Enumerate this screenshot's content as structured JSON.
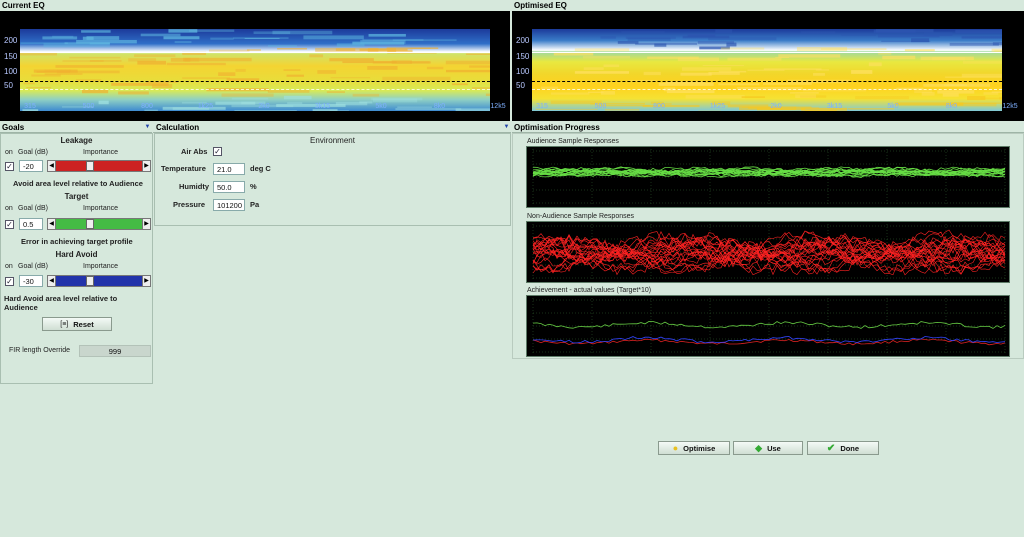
{
  "current_eq": {
    "title": "Current EQ",
    "y_ticks": [
      "200",
      "150",
      "100",
      "50"
    ],
    "x_ticks": [
      "315",
      "500",
      "800",
      "1k25",
      "2k0",
      "3k15",
      "5k0",
      "8k0",
      "12k5"
    ]
  },
  "optimised_eq": {
    "title": "Optimised EQ",
    "y_ticks": [
      "200",
      "150",
      "100",
      "50"
    ],
    "x_ticks": [
      "315",
      "500",
      "800",
      "1k25",
      "2k0",
      "3k15",
      "5k0",
      "8k0",
      "12k5"
    ]
  },
  "goals": {
    "title": "Goals",
    "leakage": {
      "header": "Leakage",
      "on_label": "on",
      "goal_label": "Goal (dB)",
      "importance_label": "Importance",
      "goal_value": "-20",
      "importance": 0.35,
      "color": "#cc2222",
      "description": "Avoid area level relative to Audience"
    },
    "target": {
      "header": "Target",
      "on_label": "on",
      "goal_label": "Goal (dB)",
      "importance_label": "Importance",
      "goal_value": "0.5",
      "importance": 0.35,
      "color": "#44bb44",
      "description": "Error in achieving target profile"
    },
    "hard_avoid": {
      "header": "Hard Avoid",
      "on_label": "on",
      "goal_label": "Goal (dB)",
      "importance_label": "Importance",
      "goal_value": "-30",
      "importance": 0.35,
      "color": "#2233aa",
      "description": "Hard Avoid area level relative to Audience"
    },
    "reset_label": "Reset",
    "fir_label": "FIR length Override",
    "fir_value": "999"
  },
  "calculation": {
    "title": "Calculation",
    "environment_header": "Environment",
    "air_abs_label": "Air Abs",
    "temperature_label": "Temperature",
    "temperature_value": "21.0",
    "temperature_unit": "deg C",
    "humidity_label": "Humidty",
    "humidity_value": "50.0",
    "humidity_unit": "%",
    "pressure_label": "Pressure",
    "pressure_value": "101200",
    "pressure_unit": "Pa"
  },
  "optimisation": {
    "title": "Optimisation Progress",
    "audience_title": "Audience Sample Responses",
    "nonaudience_title": "Non-Audience Sample Responses",
    "achievement_title": "Achievement - actual values (Target*10)"
  },
  "buttons": {
    "optimise": "Optimise",
    "use": "Use",
    "done": "Done"
  },
  "colors": {
    "background": "#d6e8dc",
    "audience": "#66dd44",
    "nonaudience": "#ff2222",
    "achievement_green": "#66cc44",
    "achievement_red": "#dd2222",
    "achievement_blue": "#3344ff"
  }
}
